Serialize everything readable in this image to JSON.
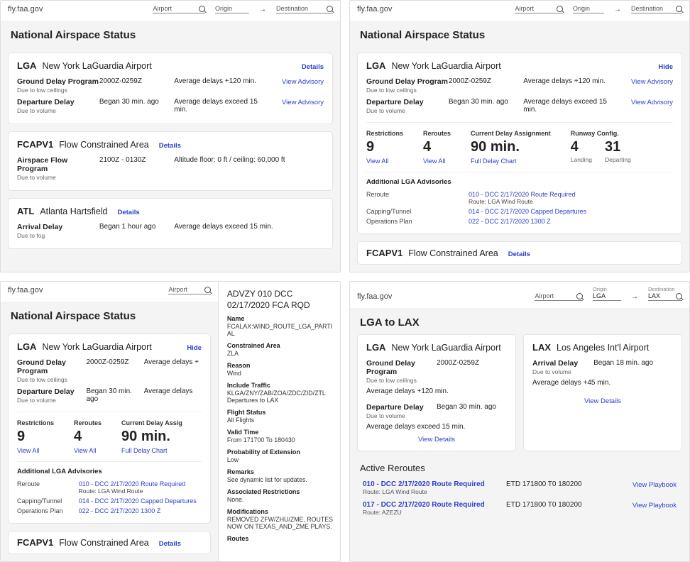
{
  "site": "fly.faa.gov",
  "search": {
    "airport": "Airport",
    "origin": "Origin",
    "destination": "Destination"
  },
  "nas_title": "National Airspace Status",
  "details": "Details",
  "hide": "Hide",
  "view_advisory": "View Advisory",
  "view_all": "View All",
  "view_details": "View Details",
  "view_playbook": "View Playbook",
  "full_delay": "Full Delay Chart",
  "lga": {
    "code": "LGA",
    "name": "New York LaGuardia Airport",
    "gdp": {
      "label": "Ground Delay Program",
      "time": "2000Z-0259Z",
      "avg": "Average delays +120 min.",
      "reason": "Due to low ceilings"
    },
    "dep": {
      "label": "Departure Delay",
      "time": "Began 30 min. ago",
      "avg": "Average delays exceed 15 min.",
      "reason": "Due to volume"
    }
  },
  "fca": {
    "code": "FCAPV1",
    "name": "Flow Constrained Area",
    "afp": {
      "label": "Airspace Flow Program",
      "time": "2100Z - 0130Z",
      "alt": "Altitude floor: 0 ft / ceiling: 60,000 ft",
      "reason": "Due to volume"
    }
  },
  "atl": {
    "code": "ATL",
    "name": "Atlanta Hartsfield",
    "arr": {
      "label": "Arrival Delay",
      "time": "Began 1 hour ago",
      "avg": "Average delays exceed 15 min.",
      "reason": "Due to fog"
    }
  },
  "metrics": {
    "restrictions": {
      "lbl": "Restrictions",
      "val": "9"
    },
    "reroutes": {
      "lbl": "Reroutes",
      "val": "4"
    },
    "delay": {
      "lbl": "Current Delay Assignment",
      "val": "90 min."
    },
    "runway": {
      "lbl": "Runway Config.",
      "land": "4",
      "landlbl": "Landing",
      "dep": "31",
      "deplbl": "Departing"
    }
  },
  "adv": {
    "title": "Additional LGA Advisories",
    "reroute": {
      "k": "Reroute",
      "v": "010 - DCC  2/17/2020 Route Required",
      "sub": "Route: LGA Wind Route"
    },
    "capping": {
      "k": "Capping/Tunnel",
      "v": "014 - DCC  2/17/2020 Capped Departures"
    },
    "ops": {
      "k": "Operations Plan",
      "v": "022 - DCC  2/17/2020 1300 Z"
    }
  },
  "drawer": {
    "h1": "ADVZY 010 DCC",
    "h2": "02/17/2020 FCA RQD",
    "name_k": "Name",
    "name_v": "FCALAX:WIND_ROUTE_LGA_PARTIAL",
    "ca_k": "Constrained Area",
    "ca_v": "ZLA",
    "reason_k": "Reason",
    "reason_v": "Wind",
    "inc_k": "Include Traffic",
    "inc_v": "KLGA/ZNY/ZAB/ZOA/ZDC/ZID/ZTL  Departures to LAX",
    "fs_k": "Flight Status",
    "fs_v": "All Flights",
    "vt_k": "Valid Time",
    "vt_v": "From 171700 To 180430",
    "pe_k": "Probability of Extension",
    "pe_v": "Low",
    "rm_k": "Remarks",
    "rm_v": "See dynamic list for updates.",
    "ar_k": "Associated Restrictions",
    "ar_v": "None.",
    "mod_k": "Modifications",
    "mod_v": "REMOVED ZFW/ZHU/ZME, ROUTES NOW ON TEXAS_AND_ZME PLAYS.",
    "routes_k": "Routes"
  },
  "p4": {
    "title": "LGA to LAX",
    "origin_filled": "LGA",
    "dest_filled": "LAX",
    "lga_gdp_label": "Ground Delay Program",
    "lga_gdp_time": "2000Z-0259Z",
    "lga_gdp_reason": "Due to low ceilings",
    "lga_gdp_avg": "Average delays +120 min.",
    "lga_dep_label": "Departure Delay",
    "lga_dep_time": "Began 30 min. ago",
    "lga_dep_reason": "Due to volume",
    "lga_dep_avg": "Average delays exceed 15 min.",
    "lax_code": "LAX",
    "lax_name": "Los Angeles Int'l Airport",
    "lax_arr_label": "Arrival Delay",
    "lax_arr_time": "Began 18 min. ago",
    "lax_arr_reason": "Due to volume",
    "lax_arr_avg": "Average delays +45 min.",
    "reroutes_h": "Active  Reroutes",
    "r1": {
      "t": "010 - DCC  2/17/2020 Route Required",
      "sub": "Route: LGA Wind Route",
      "etd": "ETD 171800 T0 180200"
    },
    "r2": {
      "t": "017 - DCC  2/17/2020 Route Required",
      "sub": "Route: AZEZU",
      "etd": "ETD 171800 T0 180200"
    }
  }
}
